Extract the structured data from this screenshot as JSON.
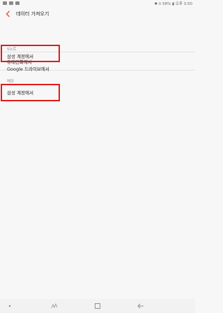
{
  "status_bar": {
    "right_text": "✱ ⦸ 58% ▮ 오후 3:50"
  },
  "header": {
    "title": "데이터 가져오기"
  },
  "sections": [
    {
      "label": "S노트",
      "items": [
        "휴대전화에서",
        "삼성 계정에서",
        "Google 드라이브에서"
      ]
    },
    {
      "label": "메모",
      "items": [
        "삼성 계정에서"
      ]
    }
  ],
  "colors": {
    "accent_back": "#e2552b",
    "highlight": "#e21a1a"
  },
  "nav_bar": {
    "icons": [
      "dot-icon",
      "recent-apps-icon",
      "home-icon",
      "back-icon"
    ]
  }
}
